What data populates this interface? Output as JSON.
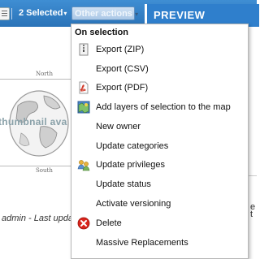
{
  "toolbar": {
    "selected_label": "2 Selected",
    "actions_label": "Other actions",
    "preview_label": "PREVIEW"
  },
  "thumbnail": {
    "north_label": "North",
    "south_label": "South",
    "placeholder_text": "thumbnail ava"
  },
  "record": {
    "meta_text": "admin - Last upda"
  },
  "preview": {
    "fragment_1": "e",
    "fragment_2": "t"
  },
  "menu": {
    "header": "On selection",
    "items": [
      {
        "label": "Export (ZIP)",
        "icon": "zip-file-icon"
      },
      {
        "label": "Export (CSV)",
        "icon": "none"
      },
      {
        "label": "Export (PDF)",
        "icon": "pdf-file-icon"
      },
      {
        "label": "Add layers of selection to the map",
        "icon": "map-layers-icon"
      },
      {
        "label": "New owner",
        "icon": "none"
      },
      {
        "label": "Update categories",
        "icon": "none"
      },
      {
        "label": "Update privileges",
        "icon": "users-icon"
      },
      {
        "label": "Update status",
        "icon": "none"
      },
      {
        "label": "Activate versioning",
        "icon": "none"
      },
      {
        "label": "Delete",
        "icon": "delete-icon"
      },
      {
        "label": "Massive Replacements",
        "icon": "none"
      }
    ]
  },
  "colors": {
    "toolbar_blue": "#2f7fcc",
    "delete_red": "#d9241b",
    "pdf_red": "#d23a2a"
  }
}
